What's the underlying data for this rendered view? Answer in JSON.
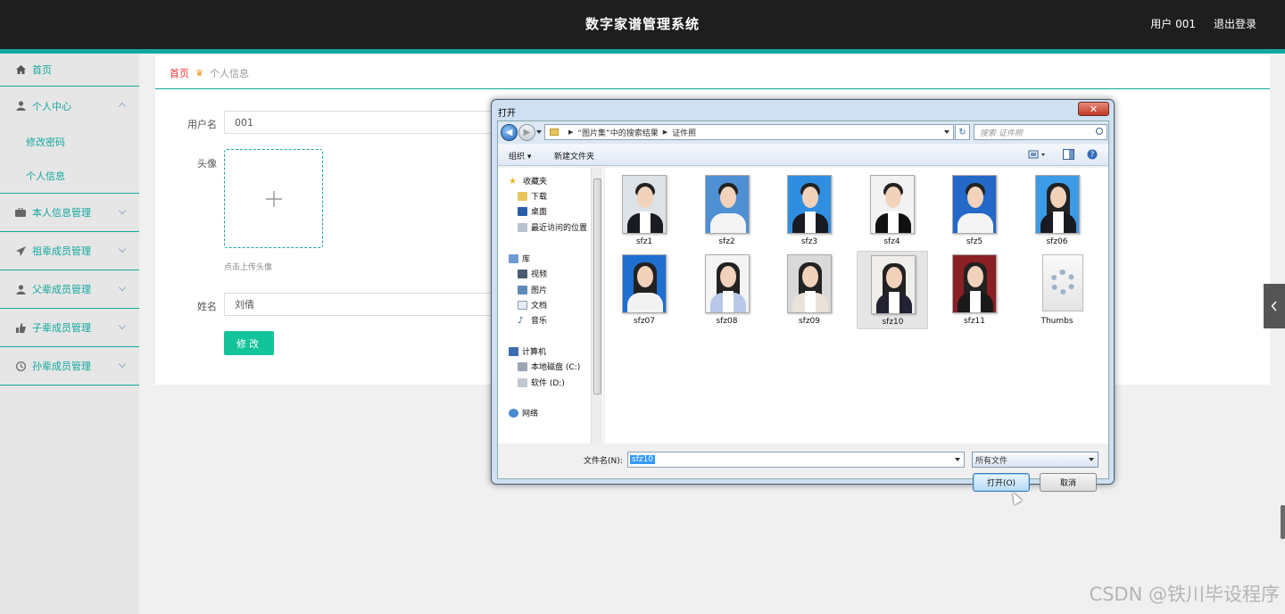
{
  "header": {
    "app_title": "数字家谱管理系统",
    "user_label": "用户 001",
    "logout": "退出登录"
  },
  "sidebar": {
    "home": "首页",
    "personal_center": "个人中心",
    "change_password": "修改密码",
    "personal_info": "个人信息",
    "groups": [
      {
        "label": "本人信息管理",
        "icon": "briefcase-icon"
      },
      {
        "label": "祖辈成员管理",
        "icon": "paper-plane-icon"
      },
      {
        "label": "父辈成员管理",
        "icon": "user-icon"
      },
      {
        "label": "子辈成员管理",
        "icon": "thumbs-up-icon"
      },
      {
        "label": "孙辈成员管理",
        "icon": "clock-icon"
      }
    ]
  },
  "breadcrumb": {
    "home": "首页",
    "current": "个人信息"
  },
  "form": {
    "username_label": "用户名",
    "username_value": "001",
    "avatar_label": "头像",
    "upload_hint": "点击上传头像",
    "name_label": "姓名",
    "name_value": "刘倩",
    "submit_label": "修改"
  },
  "dialog": {
    "title": "打开",
    "close_glyph": "✕",
    "path": [
      "“图片集”中的搜索结果",
      "证件照"
    ],
    "search_placeholder": "搜索 证件照",
    "organize": "组织 ▾",
    "new_folder": "新建文件夹",
    "tree": {
      "favorites": "收藏夹",
      "downloads": "下载",
      "desktop": "桌面",
      "recent": "最近访问的位置",
      "libraries": "库",
      "videos": "视频",
      "pictures": "图片",
      "documents": "文档",
      "music": "音乐",
      "computer": "计算机",
      "local_disk": "本地磁盘 (C:)",
      "software_disk": "软件 (D:)",
      "network": "网络"
    },
    "files": [
      {
        "name": "sfz1",
        "bg": "#dde2e6",
        "suit": "#1a1a22"
      },
      {
        "name": "sfz2",
        "bg": "#4f8fd4",
        "suit": "#f4f4f4"
      },
      {
        "name": "sfz3",
        "bg": "#2f8ee0",
        "suit": "#1a1a22"
      },
      {
        "name": "sfz4",
        "bg": "#f2f2f2",
        "suit": "#111111"
      },
      {
        "name": "sfz5",
        "bg": "#2468c8",
        "suit": "#f4f4f4"
      },
      {
        "name": "sfz06",
        "bg": "#3b9be6",
        "suit": "#1a1a22"
      },
      {
        "name": "sfz07",
        "bg": "#1e6fd0",
        "suit": "#f2f2f2"
      },
      {
        "name": "sfz08",
        "bg": "#f4f4f4",
        "suit": "#b9c8e8"
      },
      {
        "name": "sfz09",
        "bg": "#d9d9d9",
        "suit": "#e9e2d8"
      },
      {
        "name": "sfz10",
        "bg": "#f0eeea",
        "suit": "#222233"
      },
      {
        "name": "sfz11",
        "bg": "#8a1f24",
        "suit": "#1a1a1a"
      },
      {
        "name": "Thumbs",
        "bg": "#ffffff",
        "suit": "#ffffff"
      }
    ],
    "selected_file": "sfz10",
    "filename_label": "文件名(N):",
    "filename_value": "sfz10",
    "filetype": "所有文件",
    "open_label": "打开(O)",
    "cancel_label": "取消"
  },
  "watermark": "CSDN @铁川毕设程序",
  "colors": {
    "accent": "#13a89e",
    "button": "#13c49a",
    "header_bg": "#1e1e1e"
  }
}
